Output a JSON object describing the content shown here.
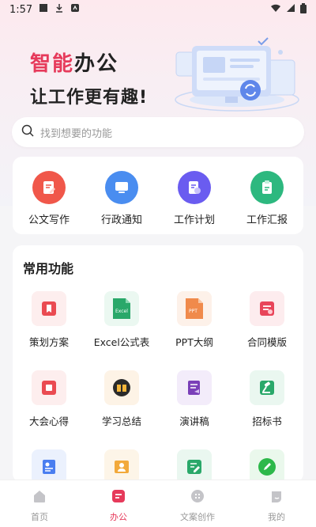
{
  "status_bar": {
    "time": "1:57"
  },
  "hero": {
    "accent_text": "智能",
    "title_rest": "办公",
    "subtitle": "让工作更有趣!"
  },
  "search": {
    "placeholder": "找到想要的功能"
  },
  "quick_actions": [
    {
      "label": "公文写作",
      "icon": "document-write-icon",
      "color": "#f0574a"
    },
    {
      "label": "行政通知",
      "icon": "monitor-icon",
      "color": "#4a8df0"
    },
    {
      "label": "工作计划",
      "icon": "plan-doc-icon",
      "color": "#6a5cf0"
    },
    {
      "label": "工作汇报",
      "icon": "report-clipboard-icon",
      "color": "#2db87f"
    }
  ],
  "common_functions": {
    "title": "常用功能",
    "items": [
      {
        "label": "策划方案",
        "icon": "plan-scheme-icon",
        "color": "#ea4b52",
        "bg": "#fdeeee"
      },
      {
        "label": "Excel公式表",
        "icon": "excel-icon",
        "color": "#2aa86a",
        "bg": "#ebf8f1",
        "icon_text": "Excel"
      },
      {
        "label": "PPT大纲",
        "icon": "ppt-icon",
        "color": "#f08a4b",
        "bg": "#fdf1e9",
        "icon_text": "PPT"
      },
      {
        "label": "合同模版",
        "icon": "contract-icon",
        "color": "#e8455a",
        "bg": "#fdecee"
      },
      {
        "label": "大会心得",
        "icon": "meeting-notes-icon",
        "color": "#ea4b52",
        "bg": "#fdeeee"
      },
      {
        "label": "学习总结",
        "icon": "study-book-icon",
        "color": "#2a2a2a",
        "bg": "#fdf3e6"
      },
      {
        "label": "演讲稿",
        "icon": "speech-draft-icon",
        "color": "#7a3fb8",
        "bg": "#f3ecfa"
      },
      {
        "label": "招标书",
        "icon": "gavel-icon",
        "color": "#2aa86a",
        "bg": "#eaf7f0"
      },
      {
        "label": "",
        "icon": "profile-doc-icon",
        "color": "#4a7ef0",
        "bg": "#ebf1fd"
      },
      {
        "label": "",
        "icon": "user-card-icon",
        "color": "#f2a93b",
        "bg": "#fdf5e8"
      },
      {
        "label": "",
        "icon": "edit-doc-icon",
        "color": "#2aa86a",
        "bg": "#eaf7f0"
      },
      {
        "label": "",
        "icon": "pen-circle-icon",
        "color": "#2db84a",
        "bg": "#eaf8ec"
      }
    ]
  },
  "bottom_nav": [
    {
      "label": "首页",
      "icon": "home-icon",
      "active": false
    },
    {
      "label": "办公",
      "icon": "office-icon",
      "active": true
    },
    {
      "label": "文案创作",
      "icon": "copywriting-icon",
      "active": false
    },
    {
      "label": "我的",
      "icon": "profile-icon",
      "active": false
    }
  ],
  "colors": {
    "accent": "#e63a5b",
    "background": "#f5f5f7"
  }
}
